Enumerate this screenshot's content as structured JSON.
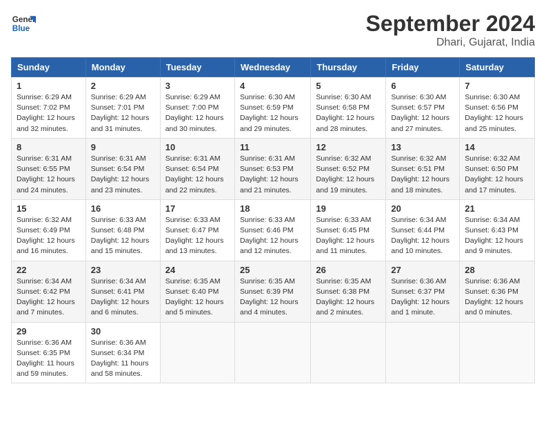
{
  "header": {
    "logo_line1": "General",
    "logo_line2": "Blue",
    "month": "September 2024",
    "location": "Dhari, Gujarat, India"
  },
  "days_of_week": [
    "Sunday",
    "Monday",
    "Tuesday",
    "Wednesday",
    "Thursday",
    "Friday",
    "Saturday"
  ],
  "weeks": [
    [
      {
        "day": "1",
        "lines": [
          "Sunrise: 6:29 AM",
          "Sunset: 7:02 PM",
          "Daylight: 12 hours",
          "and 32 minutes."
        ]
      },
      {
        "day": "2",
        "lines": [
          "Sunrise: 6:29 AM",
          "Sunset: 7:01 PM",
          "Daylight: 12 hours",
          "and 31 minutes."
        ]
      },
      {
        "day": "3",
        "lines": [
          "Sunrise: 6:29 AM",
          "Sunset: 7:00 PM",
          "Daylight: 12 hours",
          "and 30 minutes."
        ]
      },
      {
        "day": "4",
        "lines": [
          "Sunrise: 6:30 AM",
          "Sunset: 6:59 PM",
          "Daylight: 12 hours",
          "and 29 minutes."
        ]
      },
      {
        "day": "5",
        "lines": [
          "Sunrise: 6:30 AM",
          "Sunset: 6:58 PM",
          "Daylight: 12 hours",
          "and 28 minutes."
        ]
      },
      {
        "day": "6",
        "lines": [
          "Sunrise: 6:30 AM",
          "Sunset: 6:57 PM",
          "Daylight: 12 hours",
          "and 27 minutes."
        ]
      },
      {
        "day": "7",
        "lines": [
          "Sunrise: 6:30 AM",
          "Sunset: 6:56 PM",
          "Daylight: 12 hours",
          "and 25 minutes."
        ]
      }
    ],
    [
      {
        "day": "8",
        "lines": [
          "Sunrise: 6:31 AM",
          "Sunset: 6:55 PM",
          "Daylight: 12 hours",
          "and 24 minutes."
        ]
      },
      {
        "day": "9",
        "lines": [
          "Sunrise: 6:31 AM",
          "Sunset: 6:54 PM",
          "Daylight: 12 hours",
          "and 23 minutes."
        ]
      },
      {
        "day": "10",
        "lines": [
          "Sunrise: 6:31 AM",
          "Sunset: 6:54 PM",
          "Daylight: 12 hours",
          "and 22 minutes."
        ]
      },
      {
        "day": "11",
        "lines": [
          "Sunrise: 6:31 AM",
          "Sunset: 6:53 PM",
          "Daylight: 12 hours",
          "and 21 minutes."
        ]
      },
      {
        "day": "12",
        "lines": [
          "Sunrise: 6:32 AM",
          "Sunset: 6:52 PM",
          "Daylight: 12 hours",
          "and 19 minutes."
        ]
      },
      {
        "day": "13",
        "lines": [
          "Sunrise: 6:32 AM",
          "Sunset: 6:51 PM",
          "Daylight: 12 hours",
          "and 18 minutes."
        ]
      },
      {
        "day": "14",
        "lines": [
          "Sunrise: 6:32 AM",
          "Sunset: 6:50 PM",
          "Daylight: 12 hours",
          "and 17 minutes."
        ]
      }
    ],
    [
      {
        "day": "15",
        "lines": [
          "Sunrise: 6:32 AM",
          "Sunset: 6:49 PM",
          "Daylight: 12 hours",
          "and 16 minutes."
        ]
      },
      {
        "day": "16",
        "lines": [
          "Sunrise: 6:33 AM",
          "Sunset: 6:48 PM",
          "Daylight: 12 hours",
          "and 15 minutes."
        ]
      },
      {
        "day": "17",
        "lines": [
          "Sunrise: 6:33 AM",
          "Sunset: 6:47 PM",
          "Daylight: 12 hours",
          "and 13 minutes."
        ]
      },
      {
        "day": "18",
        "lines": [
          "Sunrise: 6:33 AM",
          "Sunset: 6:46 PM",
          "Daylight: 12 hours",
          "and 12 minutes."
        ]
      },
      {
        "day": "19",
        "lines": [
          "Sunrise: 6:33 AM",
          "Sunset: 6:45 PM",
          "Daylight: 12 hours",
          "and 11 minutes."
        ]
      },
      {
        "day": "20",
        "lines": [
          "Sunrise: 6:34 AM",
          "Sunset: 6:44 PM",
          "Daylight: 12 hours",
          "and 10 minutes."
        ]
      },
      {
        "day": "21",
        "lines": [
          "Sunrise: 6:34 AM",
          "Sunset: 6:43 PM",
          "Daylight: 12 hours",
          "and 9 minutes."
        ]
      }
    ],
    [
      {
        "day": "22",
        "lines": [
          "Sunrise: 6:34 AM",
          "Sunset: 6:42 PM",
          "Daylight: 12 hours",
          "and 7 minutes."
        ]
      },
      {
        "day": "23",
        "lines": [
          "Sunrise: 6:34 AM",
          "Sunset: 6:41 PM",
          "Daylight: 12 hours",
          "and 6 minutes."
        ]
      },
      {
        "day": "24",
        "lines": [
          "Sunrise: 6:35 AM",
          "Sunset: 6:40 PM",
          "Daylight: 12 hours",
          "and 5 minutes."
        ]
      },
      {
        "day": "25",
        "lines": [
          "Sunrise: 6:35 AM",
          "Sunset: 6:39 PM",
          "Daylight: 12 hours",
          "and 4 minutes."
        ]
      },
      {
        "day": "26",
        "lines": [
          "Sunrise: 6:35 AM",
          "Sunset: 6:38 PM",
          "Daylight: 12 hours",
          "and 2 minutes."
        ]
      },
      {
        "day": "27",
        "lines": [
          "Sunrise: 6:36 AM",
          "Sunset: 6:37 PM",
          "Daylight: 12 hours",
          "and 1 minute."
        ]
      },
      {
        "day": "28",
        "lines": [
          "Sunrise: 6:36 AM",
          "Sunset: 6:36 PM",
          "Daylight: 12 hours",
          "and 0 minutes."
        ]
      }
    ],
    [
      {
        "day": "29",
        "lines": [
          "Sunrise: 6:36 AM",
          "Sunset: 6:35 PM",
          "Daylight: 11 hours",
          "and 59 minutes."
        ]
      },
      {
        "day": "30",
        "lines": [
          "Sunrise: 6:36 AM",
          "Sunset: 6:34 PM",
          "Daylight: 11 hours",
          "and 58 minutes."
        ]
      },
      null,
      null,
      null,
      null,
      null
    ]
  ]
}
